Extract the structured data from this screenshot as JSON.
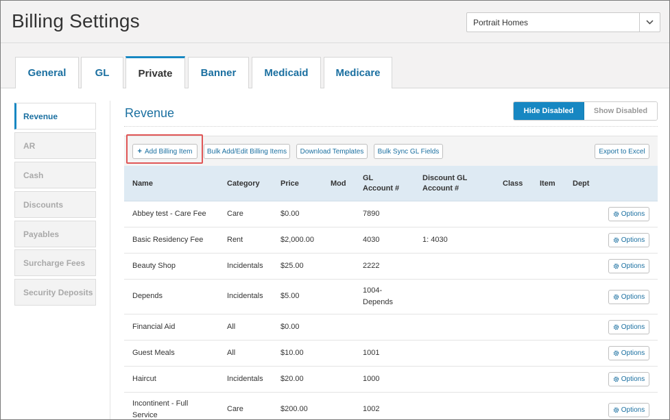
{
  "header": {
    "title": "Billing Settings",
    "facility": "Portrait Homes"
  },
  "tabs": [
    {
      "label": "General",
      "active": false
    },
    {
      "label": "GL",
      "active": false
    },
    {
      "label": "Private",
      "active": true
    },
    {
      "label": "Banner",
      "active": false
    },
    {
      "label": "Medicaid",
      "active": false
    },
    {
      "label": "Medicare",
      "active": false
    }
  ],
  "sidenav": [
    {
      "label": "Revenue",
      "active": true
    },
    {
      "label": "AR",
      "active": false
    },
    {
      "label": "Cash",
      "active": false
    },
    {
      "label": "Discounts",
      "active": false
    },
    {
      "label": "Payables",
      "active": false
    },
    {
      "label": "Surcharge Fees",
      "active": false
    },
    {
      "label": "Security Deposits",
      "active": false
    }
  ],
  "content": {
    "title": "Revenue",
    "toggle": {
      "hide": "Hide Disabled",
      "show": "Show Disabled"
    },
    "toolbar": {
      "add": "Add Billing Item",
      "bulk": "Bulk Add/Edit Billing Items",
      "download": "Download Templates",
      "sync": "Bulk Sync GL Fields",
      "export": "Export to Excel"
    }
  },
  "table": {
    "headers": {
      "name": "Name",
      "category": "Category",
      "price": "Price",
      "mod": "Mod",
      "gl_line1": "GL",
      "gl_line2": "Account #",
      "disc_line1": "Discount GL",
      "disc_line2": "Account #",
      "class": "Class",
      "item": "Item",
      "dept": "Dept"
    },
    "options_label": "Options",
    "rows": [
      {
        "name1": "Abbey test - Care Fee",
        "name2": "",
        "category": "Care",
        "price": "$0.00",
        "gl1": "7890",
        "gl2": "",
        "disc": ""
      },
      {
        "name1": "Basic Residency Fee",
        "name2": "",
        "category": "Rent",
        "price": "$2,000.00",
        "gl1": "4030",
        "gl2": "",
        "disc": "1: 4030"
      },
      {
        "name1": "Beauty Shop",
        "name2": "",
        "category": "Incidentals",
        "price": "$25.00",
        "gl1": "2222",
        "gl2": "",
        "disc": ""
      },
      {
        "name1": "Depends",
        "name2": "",
        "category": "Incidentals",
        "price": "$5.00",
        "gl1": "1004-",
        "gl2": "Depends",
        "disc": ""
      },
      {
        "name1": "Financial Aid",
        "name2": "",
        "category": "All",
        "price": "$0.00",
        "gl1": "",
        "gl2": "",
        "disc": ""
      },
      {
        "name1": "Guest Meals",
        "name2": "",
        "category": "All",
        "price": "$10.00",
        "gl1": "1001",
        "gl2": "",
        "disc": ""
      },
      {
        "name1": "Haircut",
        "name2": "",
        "category": "Incidentals",
        "price": "$20.00",
        "gl1": "1000",
        "gl2": "",
        "disc": ""
      },
      {
        "name1": "Incontinent - Full",
        "name2": "Service",
        "category": "Care",
        "price": "$200.00",
        "gl1": "1002",
        "gl2": "",
        "disc": ""
      }
    ]
  }
}
